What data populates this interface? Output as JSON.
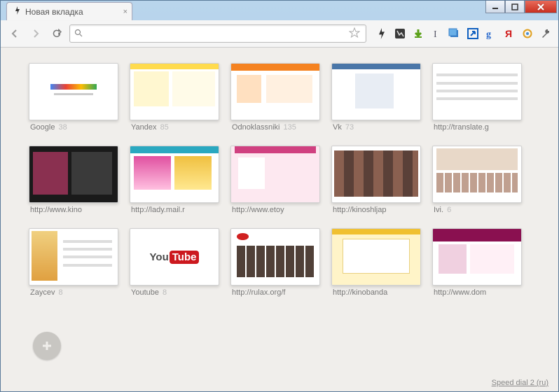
{
  "title": "Новая вкладка",
  "url_value": "",
  "footer": "Speed dial 2 (ru)",
  "window_controls": {
    "minimize": "–",
    "maximize": "▢",
    "close": "✕"
  },
  "extensions": [
    {
      "name": "bolt",
      "color": "#333"
    },
    {
      "name": "capture",
      "color": "#444"
    },
    {
      "name": "download",
      "color": "#5aa018"
    },
    {
      "name": "cursor",
      "color": "#5a5a6a"
    },
    {
      "name": "images",
      "color": "#3a80c8"
    },
    {
      "name": "share",
      "color": "#1060c0"
    },
    {
      "name": "google",
      "color": "#2a6acd"
    },
    {
      "name": "yandex",
      "color": "#d01818"
    },
    {
      "name": "settings-gear",
      "color": "#e0a020"
    },
    {
      "name": "wrench",
      "color": "#666"
    }
  ],
  "tiles": [
    {
      "label": "Google",
      "count": "38",
      "style": "google"
    },
    {
      "label": "Yandex",
      "count": "85",
      "style": "yandex"
    },
    {
      "label": "Odnoklassniki",
      "count": "135",
      "style": "ok"
    },
    {
      "label": "Vk",
      "count": "73",
      "style": "vk"
    },
    {
      "label": "http://translate.g",
      "count": "",
      "style": "plain"
    },
    {
      "label": "http://www.kino",
      "count": "",
      "style": "dark"
    },
    {
      "label": "http://lady.mail.r",
      "count": "",
      "style": "lady"
    },
    {
      "label": "http://www.etoy",
      "count": "",
      "style": "pink"
    },
    {
      "label": "http://kinoshljap",
      "count": "",
      "style": "movies"
    },
    {
      "label": "Ivi.",
      "count": "6",
      "style": "ivi"
    },
    {
      "label": "Zaycev",
      "count": "8",
      "style": "zaycev"
    },
    {
      "label": "Youtube",
      "count": "8",
      "style": "youtube"
    },
    {
      "label": "http://rulax.org/f",
      "count": "",
      "style": "rulax"
    },
    {
      "label": "http://kinobanda",
      "count": "",
      "style": "yellow"
    },
    {
      "label": "http://www.dom",
      "count": "",
      "style": "dom"
    }
  ]
}
